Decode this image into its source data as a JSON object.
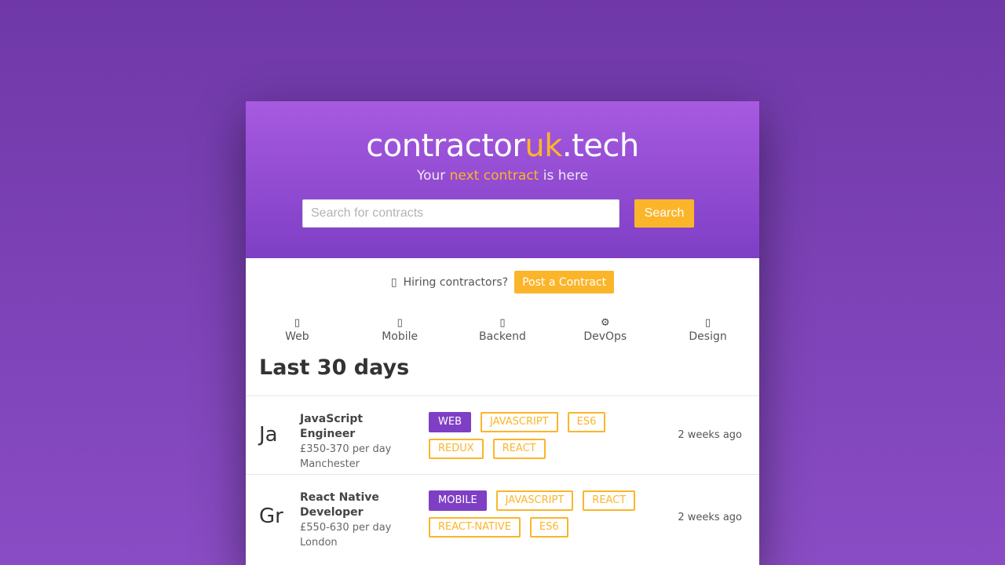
{
  "brand": {
    "logo_part1": "contractor",
    "logo_accent": "uk",
    "logo_part2": ".tech",
    "tagline_part1": "Your ",
    "tagline_accent": "next contract",
    "tagline_part2": " is here"
  },
  "search": {
    "placeholder": "Search for contracts",
    "value": "",
    "button_label": "Search"
  },
  "hiring": {
    "icon": "megaphone-icon",
    "text": "Hiring contractors?",
    "button_label": "Post a Contract"
  },
  "categories": [
    {
      "label": "Web",
      "icon": "globe-icon"
    },
    {
      "label": "Mobile",
      "icon": "mobile-icon"
    },
    {
      "label": "Backend",
      "icon": "server-icon"
    },
    {
      "label": "DevOps",
      "icon": "gear-icon"
    },
    {
      "label": "Design",
      "icon": "palette-icon"
    }
  ],
  "section_title": "Last 30 days",
  "jobs": [
    {
      "initials": "Ja",
      "title": "JavaScript Engineer",
      "rate": "£350-370 per day",
      "location": "Manchester",
      "tags": [
        "WEB",
        "JAVASCRIPT",
        "ES6",
        "REDUX",
        "REACT"
      ],
      "primary_tag": "WEB",
      "posted": "2 weeks ago"
    },
    {
      "initials": "Gr",
      "title": "React Native Developer",
      "rate": "£550-630 per day",
      "location": "London",
      "tags": [
        "MOBILE",
        "JAVASCRIPT",
        "REACT",
        "REACT-NATIVE",
        "ES6"
      ],
      "primary_tag": "MOBILE",
      "posted": "2 weeks ago"
    }
  ],
  "colors": {
    "purple": "#7e3fc5",
    "accent": "#fbb52a",
    "background": "#7a40b5"
  }
}
